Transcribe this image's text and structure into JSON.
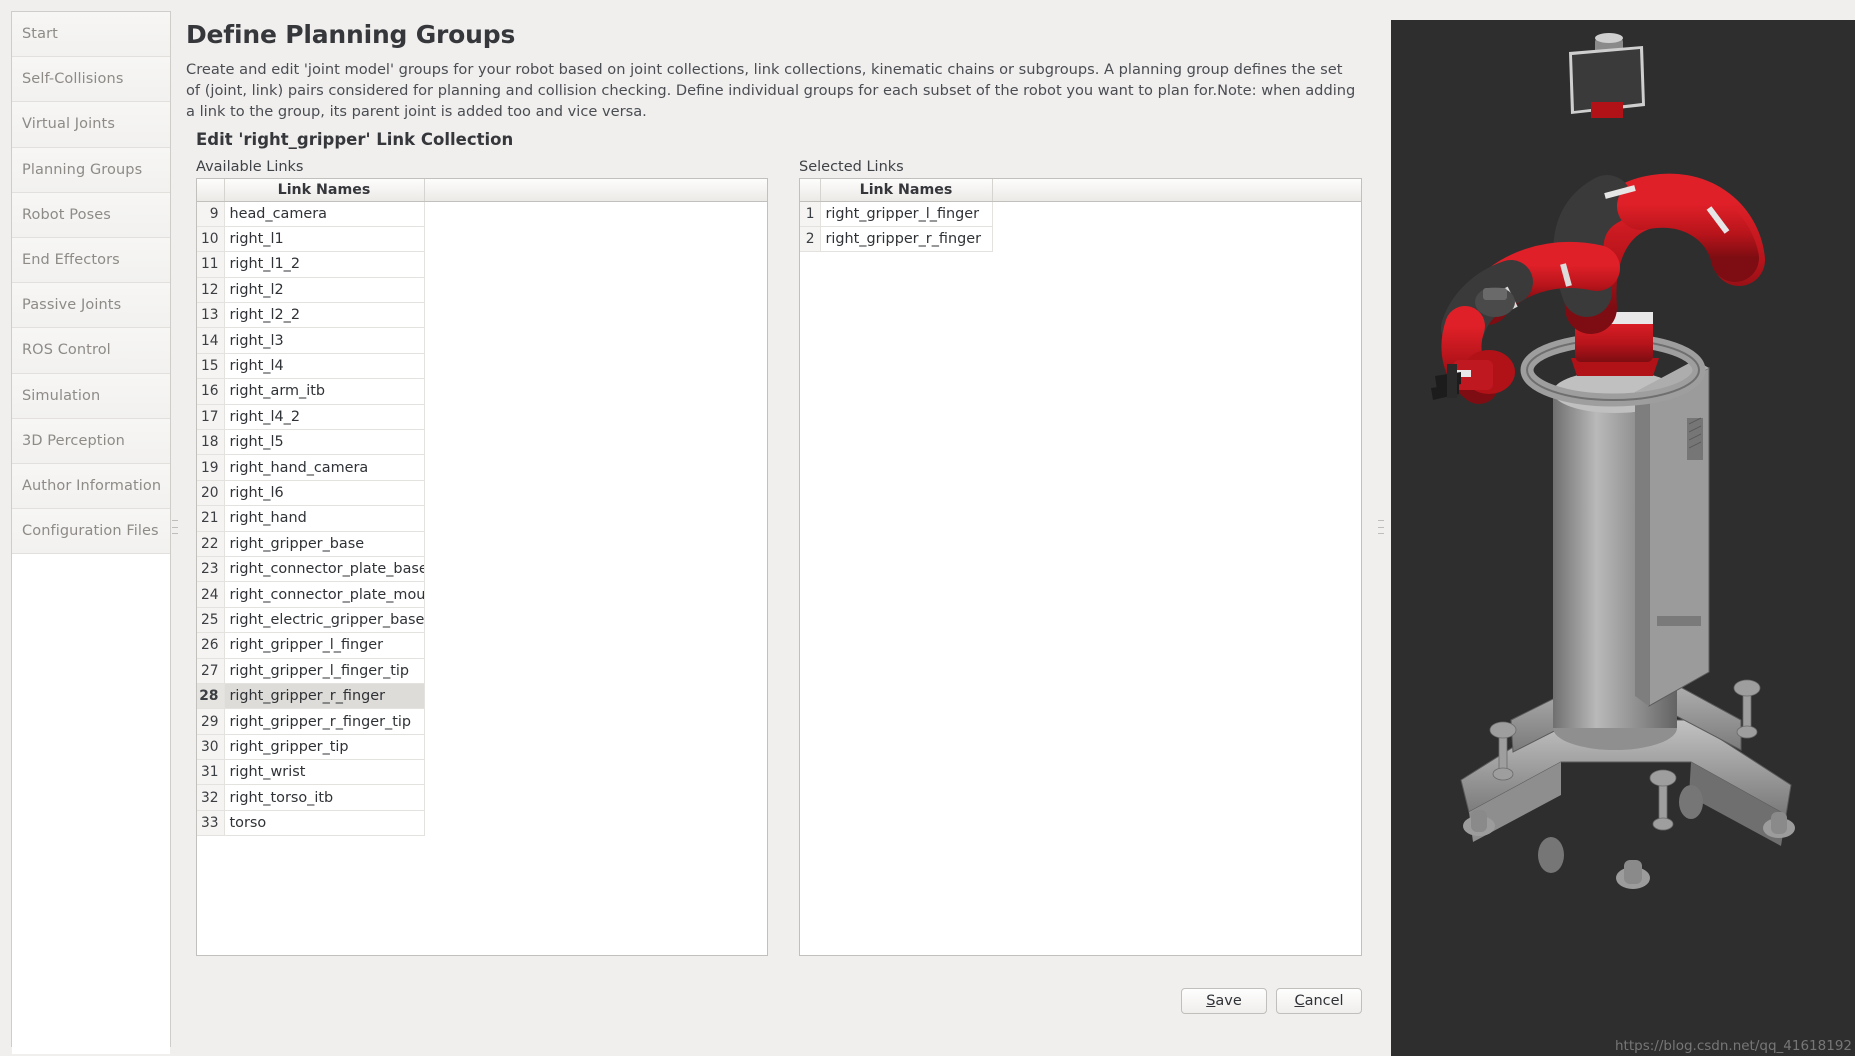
{
  "sidebar": {
    "items": [
      {
        "label": "Start",
        "name": "start"
      },
      {
        "label": "Self-Collisions",
        "name": "self-collisions"
      },
      {
        "label": "Virtual Joints",
        "name": "virtual-joints"
      },
      {
        "label": "Planning Groups",
        "name": "planning-groups"
      },
      {
        "label": "Robot Poses",
        "name": "robot-poses"
      },
      {
        "label": "End Effectors",
        "name": "end-effectors"
      },
      {
        "label": "Passive Joints",
        "name": "passive-joints"
      },
      {
        "label": "ROS Control",
        "name": "ros-control"
      },
      {
        "label": "Simulation",
        "name": "simulation"
      },
      {
        "label": "3D Perception",
        "name": "3d-perception"
      },
      {
        "label": "Author Information",
        "name": "author-information"
      },
      {
        "label": "Configuration Files",
        "name": "configuration-files"
      }
    ]
  },
  "page": {
    "title": "Define Planning Groups",
    "description": "Create and edit 'joint model' groups for your robot based on joint collections, link collections, kinematic chains or subgroups. A planning group defines the set of (joint, link) pairs considered for planning and collision checking. Define individual groups for each subset of the robot you want to plan for.Note: when adding a link to the group, its parent joint is added too and vice versa.",
    "collection_title": "Edit 'right_gripper' Link Collection"
  },
  "available": {
    "label": "Available Links",
    "column_header": "Link Names",
    "selected_index": 28,
    "rows": [
      {
        "index": "9",
        "name": "head_camera"
      },
      {
        "index": "10",
        "name": "right_l1"
      },
      {
        "index": "11",
        "name": "right_l1_2"
      },
      {
        "index": "12",
        "name": "right_l2"
      },
      {
        "index": "13",
        "name": "right_l2_2"
      },
      {
        "index": "14",
        "name": "right_l3"
      },
      {
        "index": "15",
        "name": "right_l4"
      },
      {
        "index": "16",
        "name": "right_arm_itb"
      },
      {
        "index": "17",
        "name": "right_l4_2"
      },
      {
        "index": "18",
        "name": "right_l5"
      },
      {
        "index": "19",
        "name": "right_hand_camera"
      },
      {
        "index": "20",
        "name": "right_l6"
      },
      {
        "index": "21",
        "name": "right_hand"
      },
      {
        "index": "22",
        "name": "right_gripper_base"
      },
      {
        "index": "23",
        "name": "right_connector_plate_base"
      },
      {
        "index": "24",
        "name": "right_connector_plate_mount"
      },
      {
        "index": "25",
        "name": "right_electric_gripper_base"
      },
      {
        "index": "26",
        "name": "right_gripper_l_finger"
      },
      {
        "index": "27",
        "name": "right_gripper_l_finger_tip"
      },
      {
        "index": "28",
        "name": "right_gripper_r_finger"
      },
      {
        "index": "29",
        "name": "right_gripper_r_finger_tip"
      },
      {
        "index": "30",
        "name": "right_gripper_tip"
      },
      {
        "index": "31",
        "name": "right_wrist"
      },
      {
        "index": "32",
        "name": "right_torso_itb"
      },
      {
        "index": "33",
        "name": "torso"
      }
    ]
  },
  "selected": {
    "label": "Selected Links",
    "column_header": "Link Names",
    "rows": [
      {
        "index": "1",
        "name": "right_gripper_l_finger"
      },
      {
        "index": "2",
        "name": "right_gripper_r_finger"
      }
    ]
  },
  "transfer": {
    "add_label": ">",
    "remove_label": "<"
  },
  "actions": {
    "save_label": "Save",
    "save_accel": "S",
    "save_rest": "ave",
    "cancel_label": "Cancel",
    "cancel_accel": "C",
    "cancel_rest": "ancel"
  },
  "viewport": {
    "watermark": "https://blog.csdn.net/qq_41618192",
    "background_color": "#2e2e2e",
    "robot_accent_color": "#c8181f",
    "robot_body_color": "#9a9a9a"
  }
}
